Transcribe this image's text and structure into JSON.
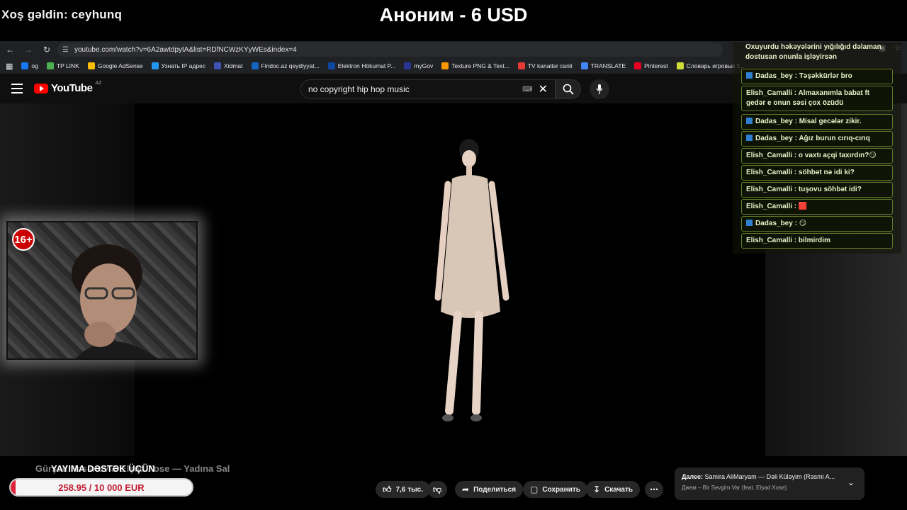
{
  "overlay": {
    "welcome": "Xoş gəldin: ceyhunq",
    "donation": "Аноним - 6 USD",
    "age_badge": "16+"
  },
  "browser": {
    "url": "youtube.com/watch?v=6A2awtdpytA&list=RDfNCWzKYyWEs&index=4",
    "bookmarks": [
      {
        "label": "og",
        "color": "#1877f2"
      },
      {
        "label": "TP LINK",
        "color": "#4caf50"
      },
      {
        "label": "Google AdSense",
        "color": "#fbbc04"
      },
      {
        "label": "Узнать IP адрес",
        "color": "#2196f3"
      },
      {
        "label": "Xidmat",
        "color": "#3f51b5"
      },
      {
        "label": "Findoc.az qeydiyyat...",
        "color": "#1565c0"
      },
      {
        "label": "Elektron Hökumat P...",
        "color": "#0d47a1"
      },
      {
        "label": "myGov",
        "color": "#283593"
      },
      {
        "label": "Texture PNG & Text...",
        "color": "#ff9800"
      },
      {
        "label": "TV kanallar canli",
        "color": "#e53935"
      },
      {
        "label": "TRANSLATE",
        "color": "#4285f4"
      },
      {
        "label": "Pinterest",
        "color": "#e60023"
      },
      {
        "label": "Словарь игровых т...",
        "color": "#cddc39"
      }
    ]
  },
  "youtube": {
    "logo": "YouTube",
    "country": "AZ",
    "search_query": "no copyright hip hop music"
  },
  "chat": {
    "top_text": "Oxuyurdu həkəyələrini yığılığıd dəlaman dostusan onunla işləyirsən",
    "messages": [
      {
        "text": "Dadas_bey : Təşəkkürlər bro",
        "icon": true
      },
      {
        "text": "Elish_Camalli : Almaxanımla babat ft gedər e onun səsi çox özüdü",
        "icon": false
      },
      {
        "text": "Dadas_bey : Misal gecələr zikir.",
        "icon": true
      },
      {
        "text": "Dadas_bey : Ağız burun cırıq-cırıq",
        "icon": true
      },
      {
        "text": "Elish_Camalli : o vaxtı açqi taxırdın?😏",
        "icon": false
      },
      {
        "text": "Elish_Camalli : söhbət nə idi ki?",
        "icon": false
      },
      {
        "text": "Elish_Camalli : tuşovu söhbət idi?",
        "icon": false
      },
      {
        "text": "Elish_Camalli : 🟥",
        "icon": false
      },
      {
        "text": "Dadas_bey : 😏",
        "icon": true
      },
      {
        "text": "Elish_Camalli : bilmirdim",
        "icon": false
      }
    ]
  },
  "video": {
    "title": "Gürşad Həsənov & Elşad Xose — Yadına Sal",
    "likes": "7,6 тыс.",
    "share": "Поделиться",
    "save": "Сохранить",
    "download": "Скачать"
  },
  "support": {
    "label": "YAYIMA DƏSTƏK ÜÇÜN",
    "progress_text": "258.95 / 10 000 EUR",
    "progress_fraction": 0.026
  },
  "next": {
    "prefix": "Далее:",
    "title": "Samira AliMaryam — Dəli Küləyim (Rəsmi A...",
    "subtitle": "Джем – Bir Sevgim Var (feat. Elşad Xose)"
  }
}
